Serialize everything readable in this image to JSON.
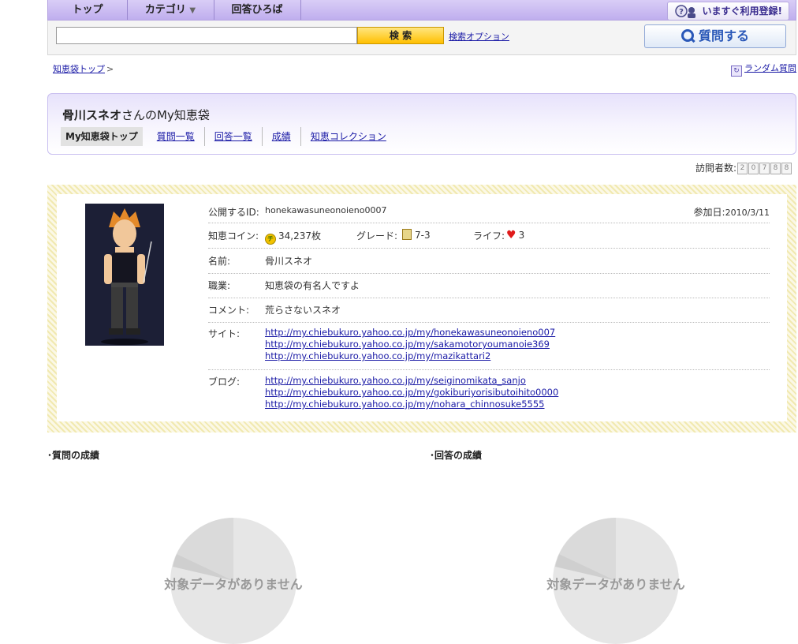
{
  "nav": {
    "tabs": [
      "トップ",
      "カテゴリ",
      "回答ひろば"
    ],
    "category_arrow": "▼",
    "register_label": "いますぐ利用登録!"
  },
  "search": {
    "value": "",
    "button_label": "検 索",
    "options_link": "検索オプション",
    "ask_label": "質問する"
  },
  "breadcrumb": {
    "home": "知恵袋トップ",
    "sep": ">"
  },
  "random_link": "ランダム質問",
  "my": {
    "title_name": "骨川スネオ",
    "title_suffix": "さんのMy知恵袋",
    "tabs": [
      "My知恵袋トップ",
      "質問一覧",
      "回答一覧",
      "成績",
      "知恵コレクション"
    ]
  },
  "visitors": {
    "label": "訪問者数:",
    "digits": [
      "2",
      "0",
      "7",
      "8",
      "8"
    ]
  },
  "profile": {
    "id_label": "公開するID:",
    "id_value": "honekawasuneonoieno0007",
    "joined_label": "参加日:",
    "joined_value": "2010/3/11",
    "coin_label": "知恵コイン:",
    "coin_icon": "チ",
    "coin_value": "34,237枚",
    "grade_label": "グレード:",
    "grade_value": "7-3",
    "life_label": "ライフ:",
    "life_icon": "♥",
    "life_value": "3",
    "name_label": "名前:",
    "name_value": "骨川スネオ",
    "job_label": "職業:",
    "job_value": "知恵袋の有名人ですよ",
    "comment_label": "コメント:",
    "comment_value": "荒らさないスネオ",
    "site_label": "サイト:",
    "sites": [
      "http://my.chiebukuro.yahoo.co.jp/my/honekawasuneonoieno007",
      "http://my.chiebukuro.yahoo.co.jp/my/sakamotoryoumanoie369",
      "http://my.chiebukuro.yahoo.co.jp/my/mazikattari2"
    ],
    "blog_label": "ブログ:",
    "blogs": [
      "http://my.chiebukuro.yahoo.co.jp/my/seiginomikata_sanjo",
      "http://my.chiebukuro.yahoo.co.jp/my/gokiburiyorisibutoihito0000",
      "http://my.chiebukuro.yahoo.co.jp/my/nohara_chinnosuke5555"
    ]
  },
  "results": {
    "question_title": "･質問の成績",
    "answer_title": "･回答の成績",
    "no_data": "対象データがありません"
  },
  "colors": {
    "nav_bg": "#c9bbf2",
    "search_button": "#ffcc00",
    "link": "#1a1aa6"
  }
}
